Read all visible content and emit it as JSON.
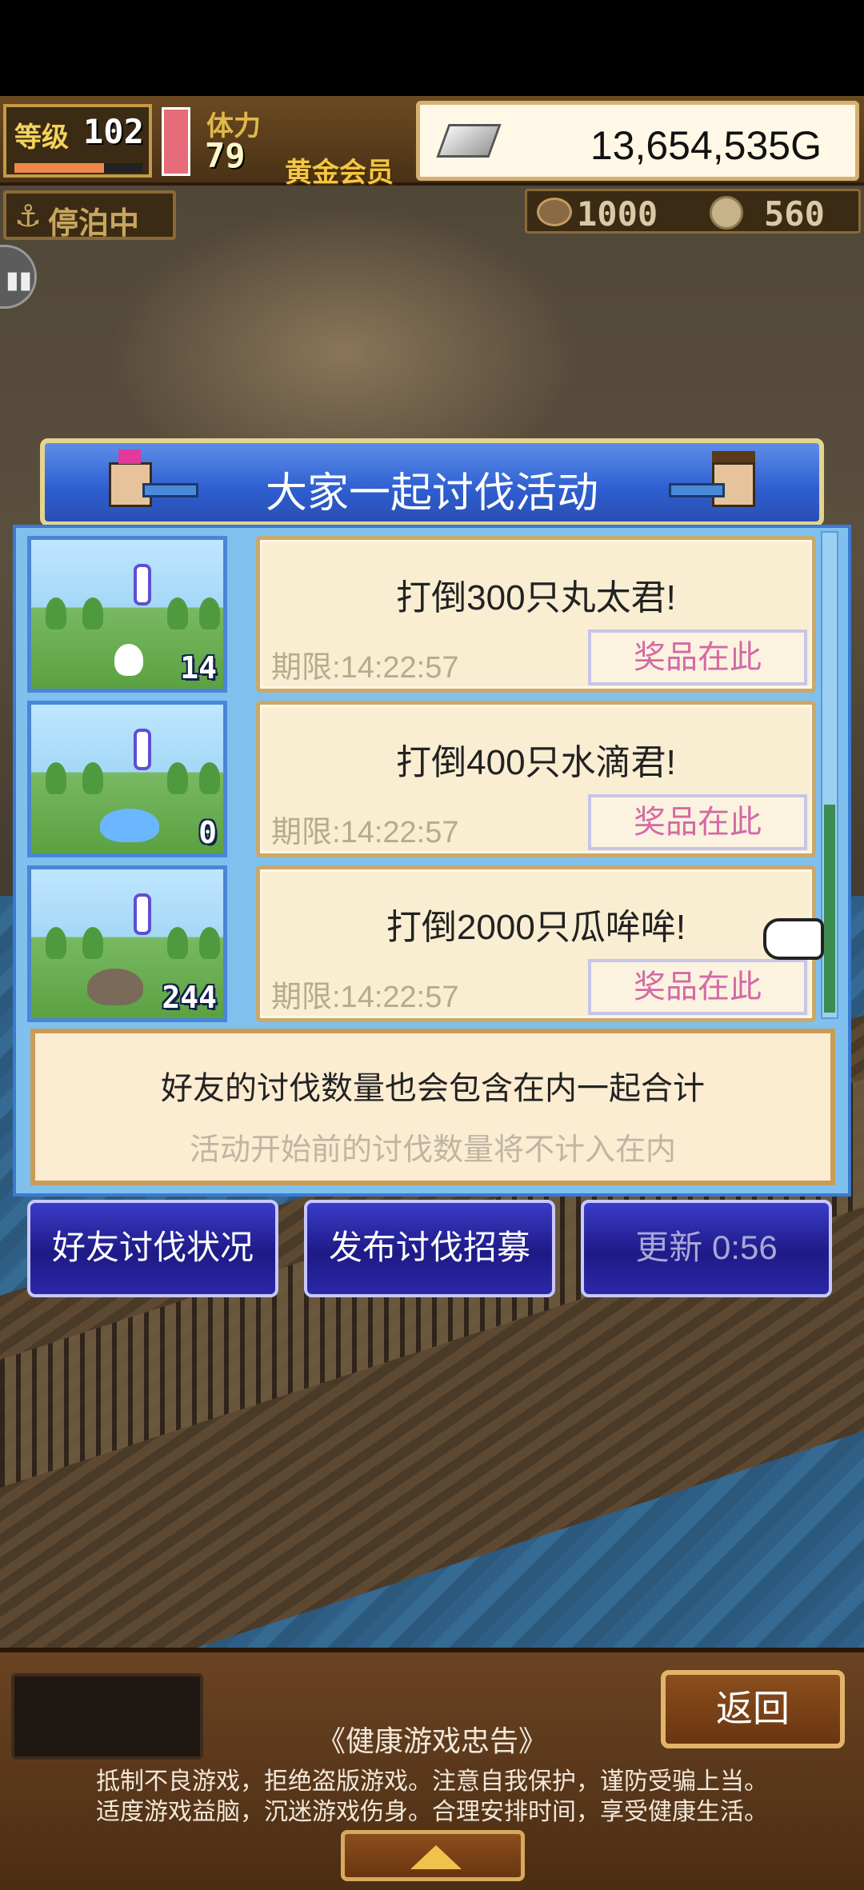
{
  "hud": {
    "level_label": "等级",
    "level_value": "102",
    "level_progress": 0.7,
    "stamina_label": "体力",
    "stamina_value": "79",
    "membership": "黄金会员",
    "gold": "13,654,535G",
    "status": "停泊中",
    "resource1": "1000",
    "resource2": "560"
  },
  "event": {
    "title": "大家一起讨伐活动",
    "quests": [
      {
        "title": "打倒300只丸太君!",
        "deadline": "期限:14:22:57",
        "prize_label": "奖品在此",
        "count": "14",
        "monster_color": "#ffffff"
      },
      {
        "title": "打倒400只水滴君!",
        "deadline": "期限:14:22:57",
        "prize_label": "奖品在此",
        "count": "0",
        "monster_color": "#6ab6ff"
      },
      {
        "title": "打倒2000只瓜哞哞!",
        "deadline": "期限:14:22:57",
        "prize_label": "奖品在此",
        "count": "244",
        "monster_color": "#7a6a5a"
      }
    ],
    "note_main": "好友的讨伐数量也会包含在内一起合计",
    "note_sub": "活动开始前的讨伐数量将不计入在内"
  },
  "actions": {
    "friend_status": "好友讨伐状况",
    "publish_recruit": "发布讨伐招募",
    "refresh": "更新 0:56"
  },
  "footer": {
    "back": "返回",
    "health_title": "《健康游戏忠告》",
    "health_line1": "抵制不良游戏，拒绝盗版游戏。注意自我保护，谨防受骗上当。",
    "health_line2": "适度游戏益脑，沉迷游戏伤身。合理安排时间，享受健康生活。"
  },
  "colors": {
    "title_bar": "#2e5ed0",
    "prize_text": "#d46aa6",
    "button_bg": "#1e1a86"
  }
}
